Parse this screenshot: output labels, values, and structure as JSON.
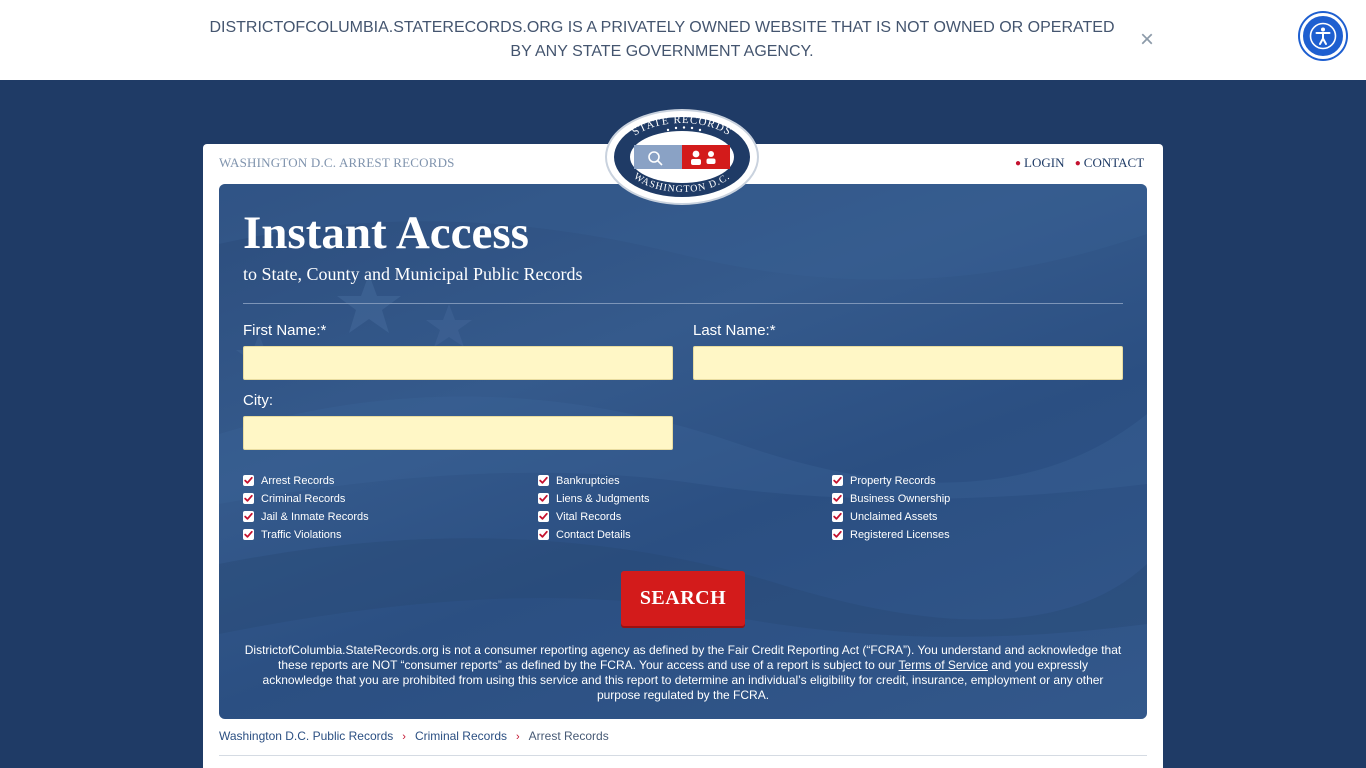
{
  "banner": {
    "text": "DISTRICTOFCOLUMBIA.STATERECORDS.ORG IS A PRIVATELY OWNED WEBSITE THAT IS NOT OWNED OR OPERATED BY ANY STATE GOVERNMENT AGENCY.",
    "close_icon": "×",
    "accessibility_icon": "accessibility-person-icon"
  },
  "header": {
    "site_label": "WASHINGTON D.C. ARREST RECORDS",
    "login": "LOGIN",
    "contact": "CONTACT",
    "logo": {
      "top_text": "STATE RECORDS",
      "bottom_text": "WASHINGTON D.C."
    }
  },
  "hero": {
    "title": "Instant Access",
    "subtitle": "to State, County and Municipal Public Records"
  },
  "form": {
    "first_name_label": "First Name:*",
    "first_name_value": "",
    "last_name_label": "Last Name:*",
    "last_name_value": "",
    "city_label": "City:",
    "city_value": "",
    "checkboxes": [
      {
        "label": "Arrest Records",
        "checked": true
      },
      {
        "label": "Criminal Records",
        "checked": true
      },
      {
        "label": "Jail & Inmate Records",
        "checked": true
      },
      {
        "label": "Traffic Violations",
        "checked": true
      },
      {
        "label": "Bankruptcies",
        "checked": true
      },
      {
        "label": "Liens & Judgments",
        "checked": true
      },
      {
        "label": "Vital Records",
        "checked": true
      },
      {
        "label": "Contact Details",
        "checked": true
      },
      {
        "label": "Property Records",
        "checked": true
      },
      {
        "label": "Business Ownership",
        "checked": true
      },
      {
        "label": "Unclaimed Assets",
        "checked": true
      },
      {
        "label": "Registered Licenses",
        "checked": true
      }
    ],
    "search_label": "SEARCH"
  },
  "disclaimer": {
    "part1": "DistrictofColumbia.StateRecords.org is not a consumer reporting agency as defined by the Fair Credit Reporting Act (“FCRA”). You understand and acknowledge that these reports are NOT “consumer reports” as defined by the FCRA. Your access and use of a report is subject to our ",
    "link": "Terms of Service",
    "part2": " and you expressly acknowledge that you are prohibited from using this service and this report to determine an individual’s eligibility for credit, insurance, employment or any other purpose regulated by the FCRA."
  },
  "breadcrumb": {
    "items": [
      "Washington D.C. Public Records",
      "Criminal Records",
      "Arrest Records"
    ],
    "separator": "›"
  },
  "colors": {
    "page_bg": "#1f3b66",
    "accent_red": "#d31b1b",
    "field_bg": "#fff7c6",
    "a11y_blue": "#1e5fd0"
  }
}
